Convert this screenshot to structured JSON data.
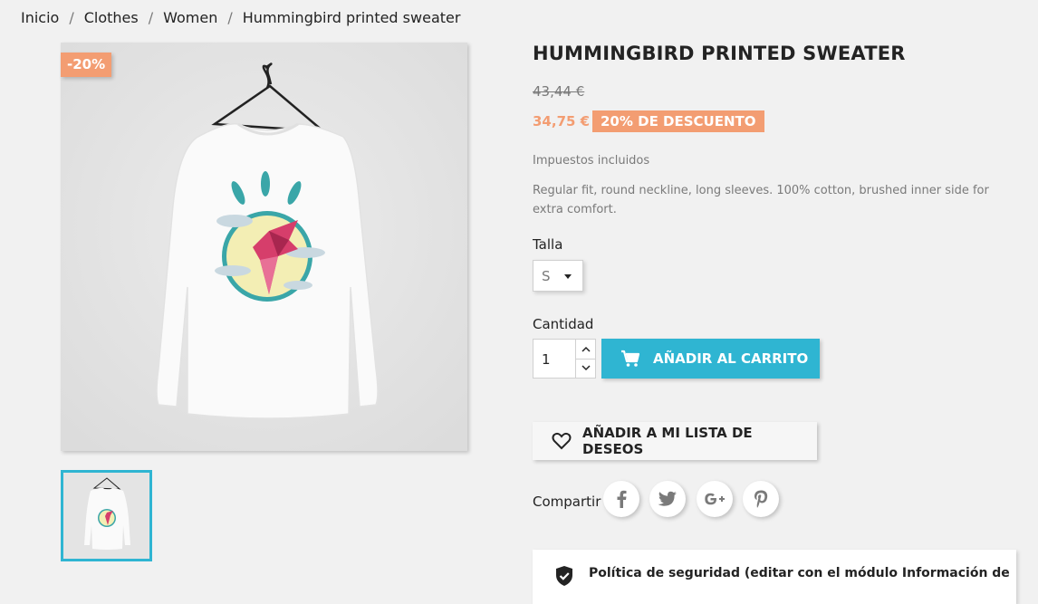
{
  "breadcrumb": {
    "items": [
      "Inicio",
      "Clothes",
      "Women",
      "Hummingbird printed sweater"
    ],
    "separator": "/"
  },
  "product": {
    "flag": "-20%",
    "title": "HUMMINGBIRD PRINTED SWEATER",
    "old_price": "43,44 €",
    "price": "34,75 €",
    "discount_badge": "20% DE DESCUENTO",
    "tax_note": "Impuestos incluidos",
    "description": "Regular fit, round neckline, long sleeves. 100% cotton, brushed inner side for extra comfort.",
    "size_label": "Talla",
    "size_value": "S",
    "quantity_label": "Cantidad",
    "quantity_value": "1",
    "add_to_cart": "AÑADIR AL CARRITO",
    "wishlist": "AÑADIR A MI LISTA DE DESEOS",
    "share_label": "Compartir",
    "social_icons": [
      "facebook-icon",
      "twitter-icon",
      "google-plus-icon",
      "pinterest-icon"
    ],
    "reassurance_text": "Política de seguridad (editar con el módulo Información de"
  },
  "colors": {
    "accent": "#2fb5d2",
    "discount": "#f39d72",
    "background": "#f1f1f1"
  }
}
